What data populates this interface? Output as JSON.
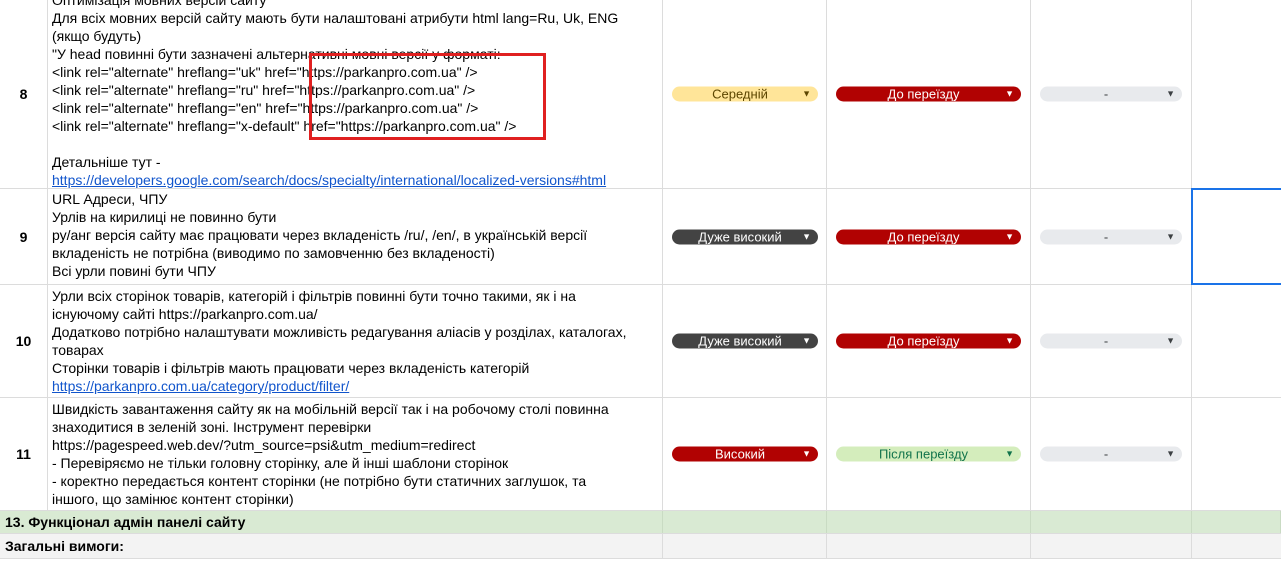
{
  "rows": [
    {
      "num": "8",
      "lines": [
        "Оптимізація мовних версій сайту",
        "Для всіх мовних версій сайту мають бути налаштовані атрибути html lang=Ru, Uk, ENG",
        "(якщо будуть)",
        "\"У head повинні бути зазначені альтернативні мовні версії у форматі:",
        "<link rel=\"alternate\" hreflang=\"uk\" href=\"https://parkanpro.com.ua\" />",
        "<link rel=\"alternate\" hreflang=\"ru\" href=\"https://parkanpro.com.ua\" />",
        "<link rel=\"alternate\" hreflang=\"en\" href=\"https://parkanpro.com.ua\" />",
        "<link rel=\"alternate\" hreflang=\"x-default\" href=\"https://parkanpro.com.ua\" />",
        "",
        "Детальніше тут -"
      ],
      "link": "https://developers.google.com/search/docs/specialty/international/localized-versions#html",
      "priority": "Середній",
      "timing": "До переїзду",
      "status": "-"
    },
    {
      "num": "9",
      "lines": [
        "URL Адреси, ЧПУ",
        "Урлів на кирилиці не повинно бути",
        "ру/анг версія сайту має працювати через вкладеність /ru/, /en/, в українській версії",
        "вкладеність не потрібна (виводимо по замовченню без вкладеності)",
        "Всі урли повині бути ЧПУ"
      ],
      "priority": "Дуже високий",
      "timing": "До переїзду",
      "status": "-"
    },
    {
      "num": "10",
      "lines": [
        "Урли всіх сторінок товарів, категорій і фільтрів повинні бути точно такими, як і на",
        "існуючому сайті https://parkanpro.com.ua/",
        "Додатково потрібно налаштувати можливість редагування аліасів у розділах, каталогах,",
        "товарах",
        "Сторінки товарів і фільтрів мають працювати через вкладеність категорій"
      ],
      "link": "https://parkanpro.com.ua/category/product/filter/",
      "priority": "Дуже високий",
      "timing": "До переїзду",
      "status": "-"
    },
    {
      "num": "11",
      "lines": [
        "Швидкість завантаження сайту як на мобільній версії так і на робочому столі повинна",
        "знаходитися в зеленій зоні. Інструмент перевірки",
        "https://pagespeed.web.dev/?utm_source=psi&utm_medium=redirect",
        "- Перевіряємо не тільки головну сторінку, але й інші шаблони сторінок",
        "- коректно передається контент сторінки (не потрібно бути статичних заглушок, та",
        "іншого, що замінює контент сторінки)"
      ],
      "priority": "Високий",
      "timing": "Після переїзду",
      "status": "-"
    }
  ],
  "section_title": "13. Функціонал адмін панелі сайту",
  "subsection_title": "Загальні вимоги:",
  "icons": {
    "dropdown": "dropdown-arrow-icon"
  },
  "colors": {
    "section_bg": "#d9ead3",
    "chip_medium": "#ffe599",
    "chip_very_high": "#434343",
    "chip_high": "#b10202",
    "chip_after_move": "#d4edbc",
    "chip_none": "#e8eaed",
    "link": "#1155cc",
    "highlight_box": "#e02020",
    "selection": "#1a73e8"
  }
}
